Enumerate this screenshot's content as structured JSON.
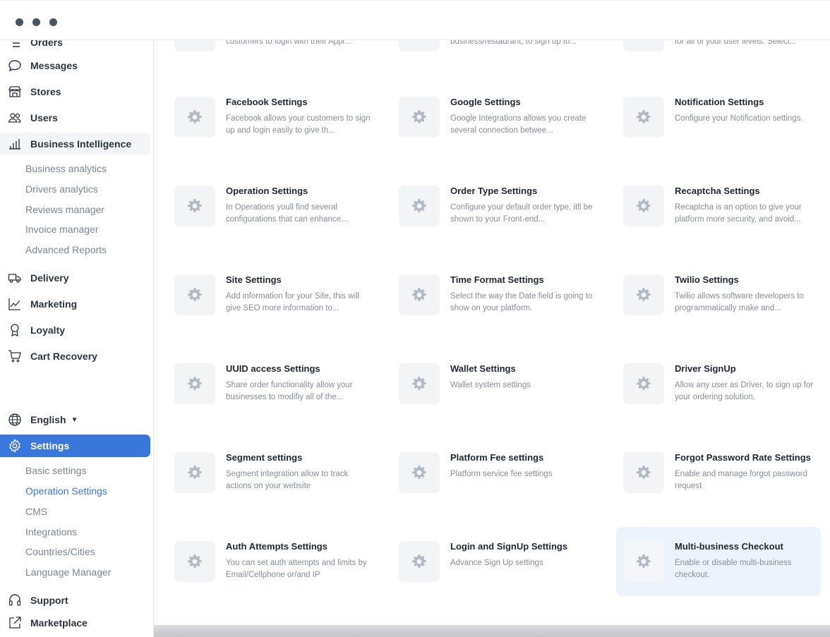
{
  "sidebar": {
    "partial_item": "Orders",
    "items": [
      {
        "label": "Messages",
        "icon": "chat-bubble-icon"
      },
      {
        "label": "Stores",
        "icon": "storefront-icon"
      },
      {
        "label": "Users",
        "icon": "users-icon"
      },
      {
        "label": "Business Intelligence",
        "icon": "bar-chart-icon"
      }
    ],
    "bi_sub": [
      "Business analytics",
      "Drivers analytics",
      "Reviews manager",
      "Invoice manager",
      "Advanced Reports"
    ],
    "items2": [
      {
        "label": "Delivery",
        "icon": "truck-icon"
      },
      {
        "label": "Marketing",
        "icon": "trend-line-icon"
      },
      {
        "label": "Loyalty",
        "icon": "award-icon"
      },
      {
        "label": "Cart Recovery",
        "icon": "cart-icon"
      }
    ],
    "language": "English",
    "settings_label": "Settings",
    "settings_sub": [
      "Basic settings",
      "Operation Settings",
      "CMS",
      "Integrations",
      "Countries/Cities",
      "Language Manager"
    ],
    "active_sub": "Operation Settings",
    "support": "Support",
    "marketplace": "Marketplace"
  },
  "cards_partial": [
    {
      "desc": "customers to login with their Appl..."
    },
    {
      "desc": "business/restaurant, to sign up fo..."
    },
    {
      "desc": "for all of your user levels. Select..."
    }
  ],
  "cards": [
    {
      "title": "Facebook Settings",
      "desc": "Facebook allows your customers to sign up and login easily to give th..."
    },
    {
      "title": "Google Settings",
      "desc": "Google Integrations allows you create several connection betwee..."
    },
    {
      "title": "Notification Settings",
      "desc": "Configure your Notification settings."
    },
    {
      "title": "Operation Settings",
      "desc": "In Operations youll find several configurations that can enhance..."
    },
    {
      "title": "Order Type Settings",
      "desc": "Configure your default order type, itll be shown to your Front-end..."
    },
    {
      "title": "Recaptcha Settings",
      "desc": "Recaptcha is an option to give your platform more security, and avoid..."
    },
    {
      "title": "Site Settings",
      "desc": "Add information for your Site, this will give SEO more information to..."
    },
    {
      "title": "Time Format Settings",
      "desc": "Select the way the Date field is going to show on your platform."
    },
    {
      "title": "Twilio Settings",
      "desc": "Twilio allows software developers to programmatically make and..."
    },
    {
      "title": "UUID access Settings",
      "desc": "Share order functionality allow your businesses to modifiy all of the..."
    },
    {
      "title": "Wallet Settings",
      "desc": "Wallet system settings"
    },
    {
      "title": "Driver SignUp",
      "desc": "Allow any user as Driver, to sign up for your ordering solution."
    },
    {
      "title": "Segment settings",
      "desc": "Segment integration allow to track actions on your website"
    },
    {
      "title": "Platform Fee settings",
      "desc": "Platform service fee settings"
    },
    {
      "title": "Forgot Password Rate Settings",
      "desc": "Enable and manage forgot password request"
    },
    {
      "title": "Auth Attempts Settings",
      "desc": "You can set auth attempts and limits by Email/Cellphone or/and IP"
    },
    {
      "title": "Login and SignUp Settings",
      "desc": "Advance Sign Up settings"
    },
    {
      "title": "Multi-business Checkout",
      "desc": "Enable or disable multi-business checkout."
    }
  ],
  "colors": {
    "accent": "#3a77db",
    "highlight": "#edf3fd",
    "icon_gray": "#b3b9c2"
  }
}
